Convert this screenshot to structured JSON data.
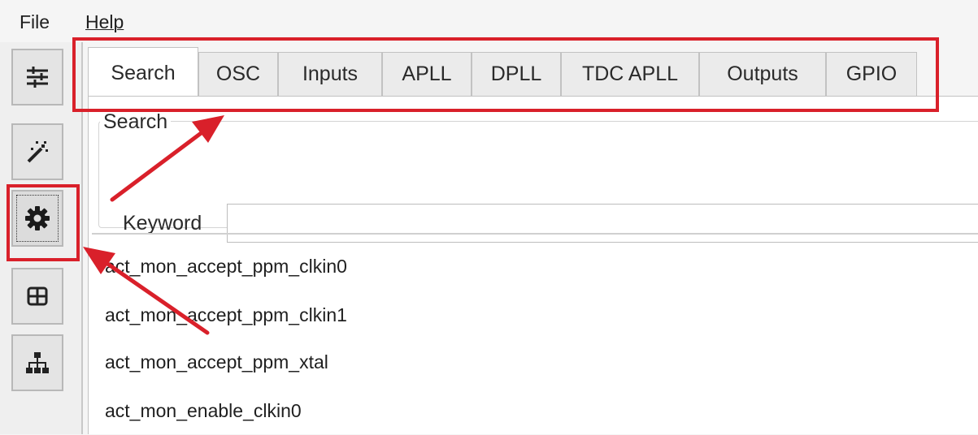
{
  "menubar": {
    "file": "File",
    "help": "Help"
  },
  "toolbar": {
    "buttons": [
      {
        "icon": "sliders-icon"
      },
      {
        "icon": "magic-wand-icon"
      },
      {
        "icon": "gear-icon",
        "selected": true
      },
      {
        "icon": "table-icon"
      },
      {
        "icon": "hierarchy-icon"
      }
    ]
  },
  "tabs": [
    "Search",
    "OSC",
    "Inputs",
    "APLL",
    "DPLL",
    "TDC APLL",
    "Outputs",
    "GPIO"
  ],
  "active_tab": "Search",
  "search": {
    "group_title": "Search",
    "keyword_label": "Keyword",
    "keyword_value": ""
  },
  "results": [
    "act_mon_accept_ppm_clkin0",
    "act_mon_accept_ppm_clkin1",
    "act_mon_accept_ppm_xtal",
    "act_mon_enable_clkin0"
  ],
  "annotation_color": "#d9202a"
}
